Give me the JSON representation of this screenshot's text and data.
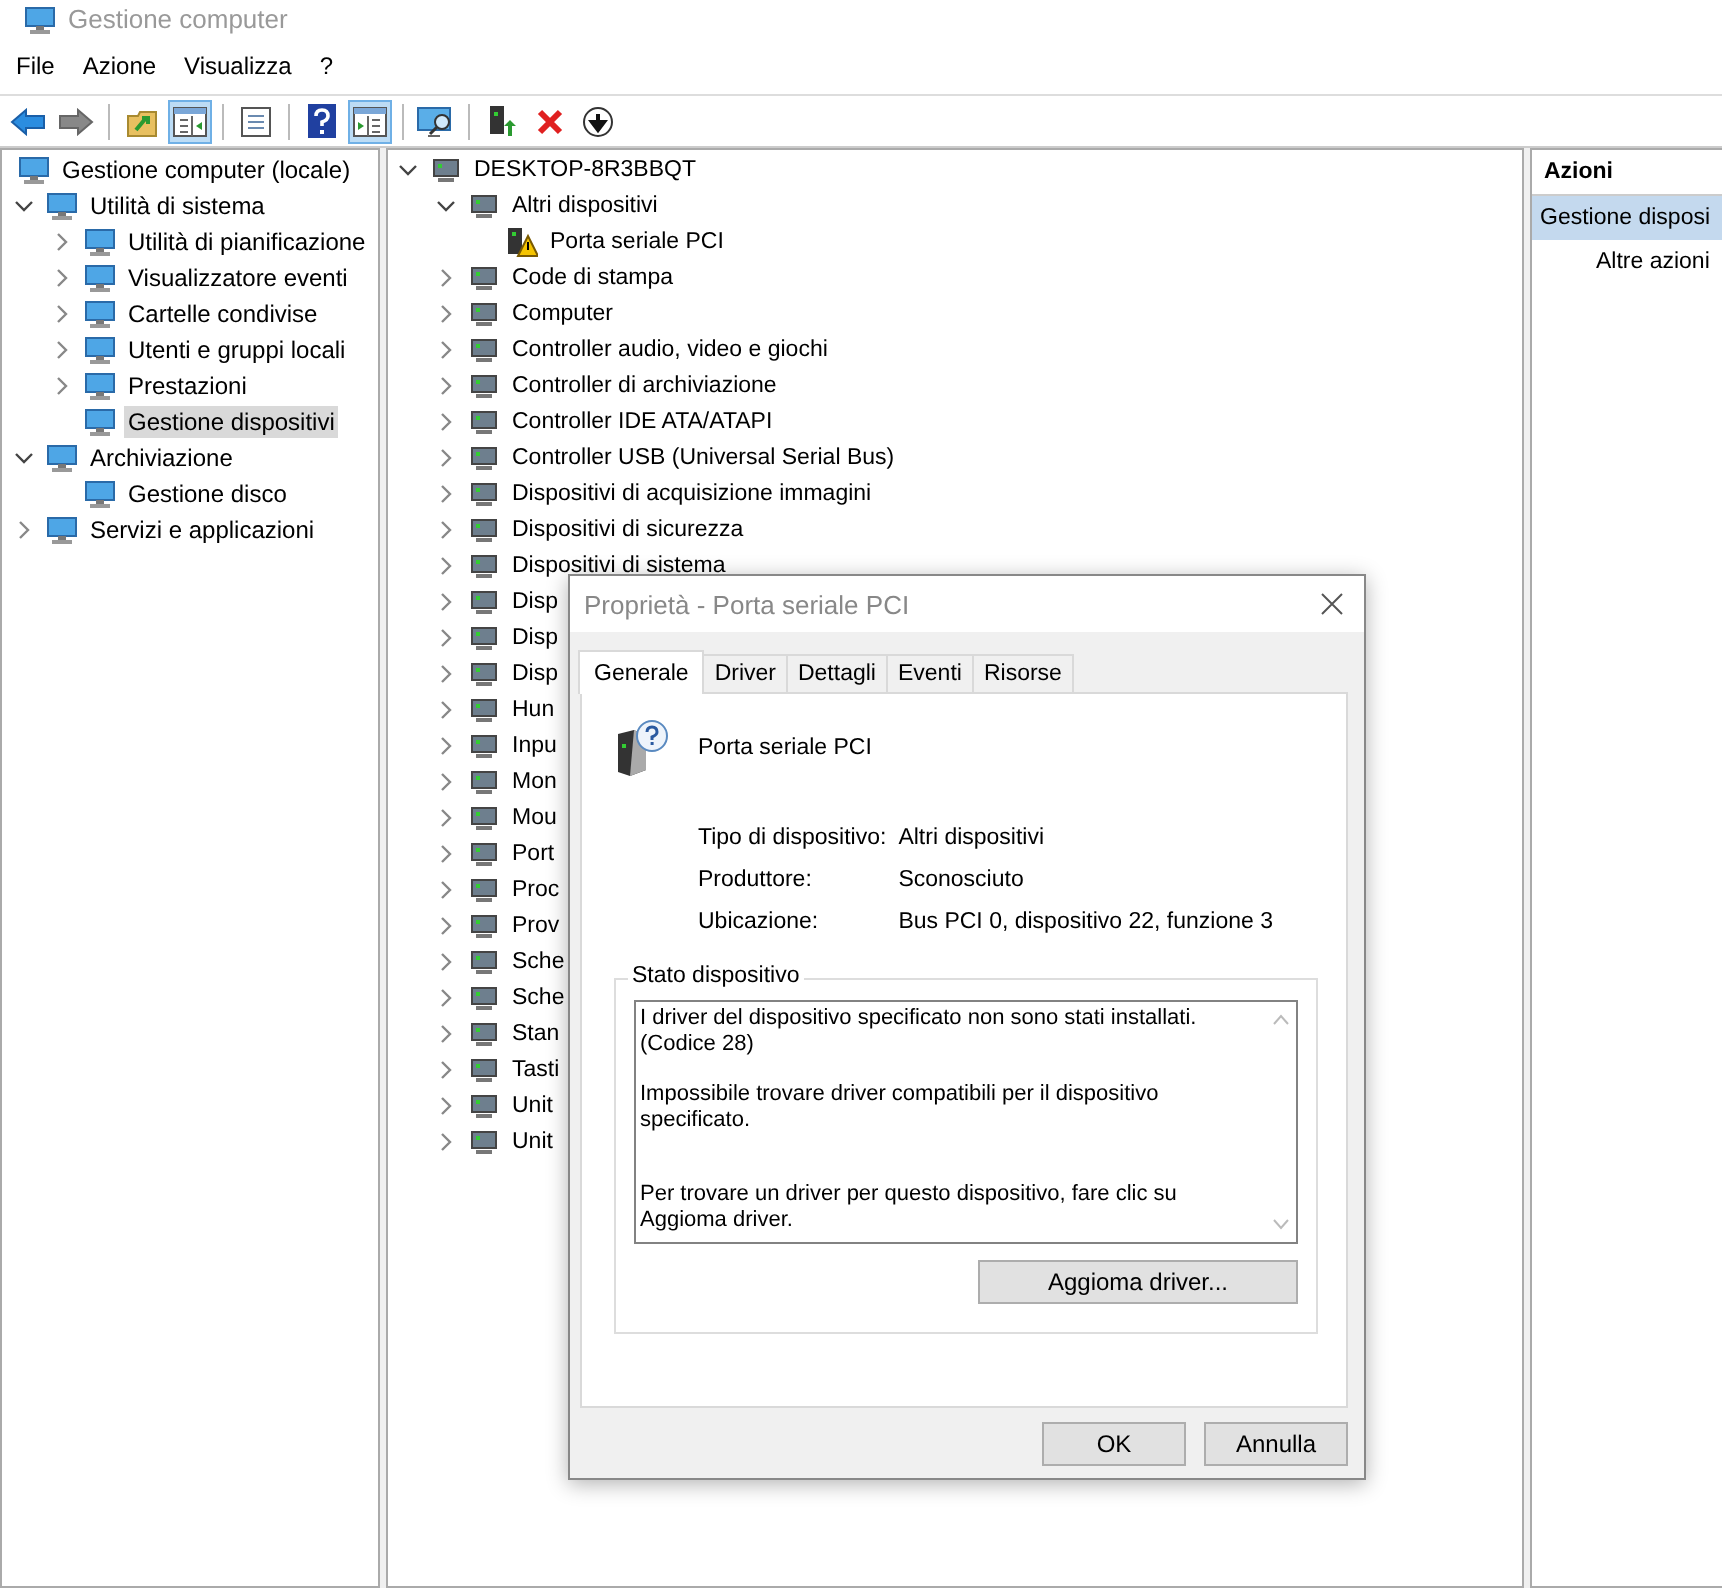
{
  "window": {
    "title": "Gestione computer"
  },
  "menu": [
    "File",
    "Azione",
    "Visualizza",
    "?"
  ],
  "toolbar": [
    {
      "kind": "back",
      "pressed": false
    },
    {
      "kind": "forward",
      "pressed": false
    },
    {
      "kind": "separator"
    },
    {
      "kind": "up",
      "pressed": false
    },
    {
      "kind": "tree",
      "pressed": true
    },
    {
      "kind": "separator"
    },
    {
      "kind": "properties",
      "pressed": false
    },
    {
      "kind": "separator"
    },
    {
      "kind": "help",
      "pressed": false
    },
    {
      "kind": "actionpane",
      "pressed": true
    },
    {
      "kind": "separator"
    },
    {
      "kind": "scan",
      "pressed": false
    },
    {
      "kind": "separator"
    },
    {
      "kind": "enable",
      "pressed": false
    },
    {
      "kind": "remove",
      "pressed": false
    },
    {
      "kind": "disable",
      "pressed": false
    }
  ],
  "console_tree": [
    {
      "label": "Gestione computer (locale)",
      "selected": false,
      "children": [
        {
          "label": "Utilità di sistema",
          "expanded": true,
          "selected": false,
          "children": [
            {
              "label": "Utilità di pianificazione",
              "expanded": false,
              "selected": false
            },
            {
              "label": "Visualizzatore eventi",
              "expanded": false,
              "selected": false
            },
            {
              "label": "Cartelle condivise",
              "expanded": false,
              "selected": false
            },
            {
              "label": "Utenti e gruppi locali",
              "expanded": false,
              "selected": false
            },
            {
              "label": "Prestazioni",
              "expanded": false,
              "selected": false
            },
            {
              "label": "Gestione dispositivi",
              "selected": true
            }
          ]
        },
        {
          "label": "Archiviazione",
          "expanded": true,
          "selected": false,
          "children": [
            {
              "label": "Gestione disco",
              "selected": false
            }
          ]
        },
        {
          "label": "Servizi e applicazioni",
          "expanded": false,
          "selected": false
        }
      ]
    }
  ],
  "device_tree": [
    {
      "label": "DESKTOP-8R3BBQT",
      "expanded": true,
      "warning": false,
      "children": [
        {
          "label": "Altri dispositivi",
          "expanded": true,
          "warning": false,
          "children": [
            {
              "label": "Porta seriale PCI",
              "warning": true
            }
          ]
        },
        {
          "label": "Code di stampa",
          "expanded": false,
          "warning": false
        },
        {
          "label": "Computer",
          "expanded": false,
          "warning": false
        },
        {
          "label": "Controller audio, video e giochi",
          "expanded": false,
          "warning": false
        },
        {
          "label": "Controller di archiviazione",
          "expanded": false,
          "warning": false
        },
        {
          "label": "Controller IDE ATA/ATAPI",
          "expanded": false,
          "warning": false
        },
        {
          "label": "Controller USB (Universal Serial Bus)",
          "expanded": false,
          "warning": false
        },
        {
          "label": "Dispositivi di acquisizione immagini",
          "expanded": false,
          "warning": false
        },
        {
          "label": "Dispositivi di sicurezza",
          "expanded": false,
          "warning": false
        },
        {
          "label": "Dispositivi di sistema",
          "expanded": false,
          "warning": false
        },
        {
          "label": "Disp",
          "expanded": false,
          "warning": false
        },
        {
          "label": "Disp",
          "expanded": false,
          "warning": false
        },
        {
          "label": "Disp",
          "expanded": false,
          "warning": false
        },
        {
          "label": "Hun",
          "expanded": false,
          "warning": false
        },
        {
          "label": "Inpu",
          "expanded": false,
          "warning": false
        },
        {
          "label": "Mon",
          "expanded": false,
          "warning": false
        },
        {
          "label": "Mou",
          "expanded": false,
          "warning": false
        },
        {
          "label": "Port",
          "expanded": false,
          "warning": false
        },
        {
          "label": "Proc",
          "expanded": false,
          "warning": false
        },
        {
          "label": "Prov",
          "expanded": false,
          "warning": false
        },
        {
          "label": "Sche",
          "expanded": false,
          "warning": false
        },
        {
          "label": "Sche",
          "expanded": false,
          "warning": false
        },
        {
          "label": "Stan",
          "expanded": false,
          "warning": false
        },
        {
          "label": "Tasti",
          "expanded": false,
          "warning": false
        },
        {
          "label": "Unit",
          "expanded": false,
          "warning": false
        },
        {
          "label": "Unit",
          "expanded": false,
          "warning": false
        }
      ]
    }
  ],
  "actions": {
    "header": "Azioni",
    "items": [
      {
        "label": "Gestione disposi",
        "selected": true
      },
      {
        "label": "Altre azioni",
        "selected": false
      }
    ]
  },
  "dialog": {
    "title": "Proprietà - Porta seriale PCI",
    "tabs": [
      {
        "label": "Generale",
        "selected": true
      },
      {
        "label": "Driver",
        "selected": false
      },
      {
        "label": "Dettagli",
        "selected": false
      },
      {
        "label": "Eventi",
        "selected": false
      },
      {
        "label": "Risorse",
        "selected": false
      }
    ],
    "device_name": "Porta seriale PCI",
    "properties": [
      {
        "label": "Tipo di dispositivo:",
        "value": "Altri dispositivi"
      },
      {
        "label": "Produttore:",
        "value": "Sconosciuto"
      },
      {
        "label": "Ubicazione:",
        "value": "Bus PCI 0, dispositivo 22, funzione 3"
      }
    ],
    "status_group": "Stato dispositivo",
    "status_messages": [
      "I driver del dispositivo specificato non sono stati installati. (Codice 28)",
      "Impossibile trovare driver compatibili per il dispositivo specificato.",
      "Per trovare un driver per questo dispositivo, fare clic su Aggioma driver."
    ],
    "update_button": "Aggioma driver...",
    "buttons": [
      "OK",
      "Annulla"
    ]
  }
}
